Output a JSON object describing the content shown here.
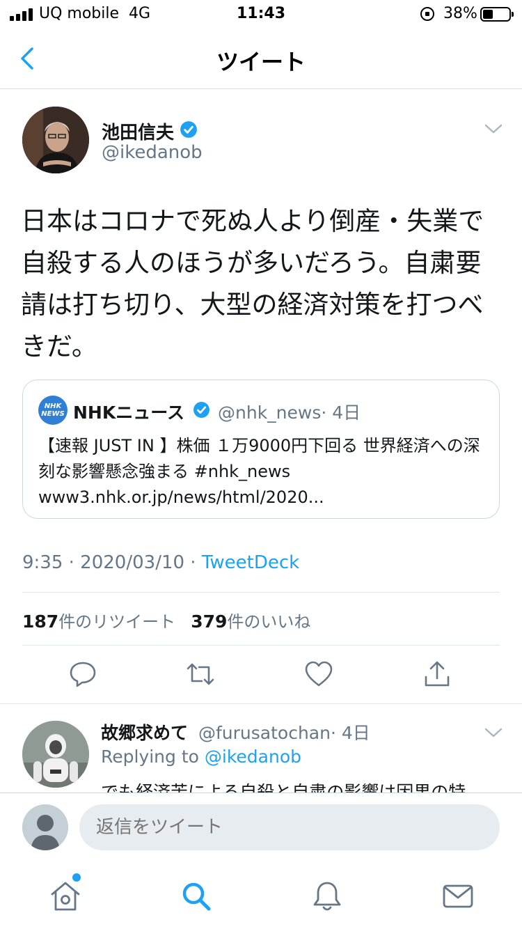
{
  "status_bar": {
    "carrier": "UQ mobile",
    "network": "4G",
    "time": "11:43",
    "battery_percent": "38%",
    "battery_level": 0.38
  },
  "nav": {
    "title": "ツイート",
    "back_icon": "chevron-left-icon"
  },
  "tweet": {
    "author_name": "池田信夫",
    "author_handle": "@ikedanob",
    "verified": true,
    "text": "日本はコロナで死ぬ人より倒産・失業で自殺する人のほうが多いだろう。自粛要請は打ち切り、大型の経済対策を打つべきだ。",
    "quote": {
      "logo_text": "NHK NEWS",
      "name": "NHKニュース",
      "handle": "@nhk_news",
      "age": "· 4日",
      "text": "【速報 JUST IN 】株価 １万9000円下回る 世界経済への深刻な影響懸念強まる #nhk_news www3.nhk.or.jp/news/html/2020..."
    },
    "time": "9:35 · 2020/03/10 · ",
    "source": "TweetDeck",
    "retweet_count": "187",
    "retweet_label": "件のリツイート",
    "like_count": "379",
    "like_label": "件のいいね"
  },
  "actions": [
    "reply-icon",
    "retweet-icon",
    "like-icon",
    "share-icon"
  ],
  "reply": {
    "name": "故郷求めて",
    "handle": "@furusatochan",
    "age": "· 4日",
    "replying_to_label": "Replying to ",
    "replying_to_handle": "@ikedanob",
    "text": "でも経済苦による自殺と自粛の影響は因果の特"
  },
  "compose": {
    "placeholder": "返信をツイート"
  },
  "tabs": [
    "home-icon",
    "search-icon",
    "notifications-icon",
    "messages-icon"
  ],
  "colors": {
    "accent": "#1da1f2",
    "text": "#14171a",
    "secondary_text": "#657786",
    "nhk_blue": "#2f7fd6"
  }
}
